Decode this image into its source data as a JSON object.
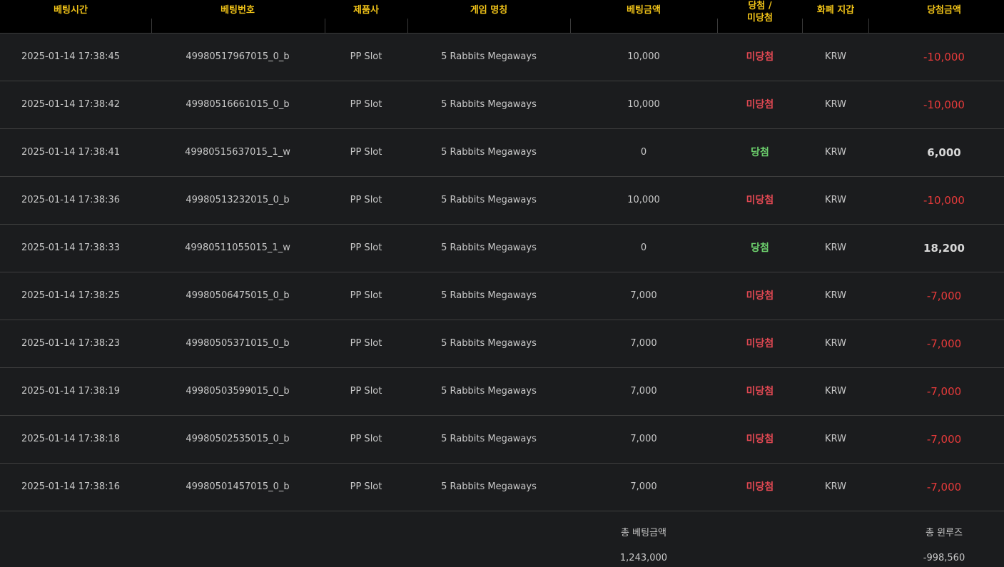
{
  "header": {
    "columns": [
      "베팅시간",
      "베팅번호",
      "제품사",
      "게임 명칭",
      "베팅금액",
      "당첨 /",
      "미당첨",
      "화폐 지갑",
      "당첨금액"
    ]
  },
  "rows": [
    {
      "time": "2025-01-14 17:38:45",
      "bet_id": "49980517967015_0_b",
      "provider": "PP Slot",
      "game": "5 Rabbits Megaways",
      "bet_amount": "10,000",
      "result": "미당첨",
      "result_type": "lose",
      "currency": "KRW",
      "win_amount": "-10,000"
    },
    {
      "time": "2025-01-14 17:38:42",
      "bet_id": "49980516661015_0_b",
      "provider": "PP Slot",
      "game": "5 Rabbits Megaways",
      "bet_amount": "10,000",
      "result": "미당첨",
      "result_type": "lose",
      "currency": "KRW",
      "win_amount": "-10,000"
    },
    {
      "time": "2025-01-14 17:38:41",
      "bet_id": "49980515637015_1_w",
      "provider": "PP Slot",
      "game": "5 Rabbits Megaways",
      "bet_amount": "0",
      "result": "당첨",
      "result_type": "win",
      "currency": "KRW",
      "win_amount": "6,000"
    },
    {
      "time": "2025-01-14 17:38:36",
      "bet_id": "49980513232015_0_b",
      "provider": "PP Slot",
      "game": "5 Rabbits Megaways",
      "bet_amount": "10,000",
      "result": "미당첨",
      "result_type": "lose",
      "currency": "KRW",
      "win_amount": "-10,000"
    },
    {
      "time": "2025-01-14 17:38:33",
      "bet_id": "49980511055015_1_w",
      "provider": "PP Slot",
      "game": "5 Rabbits Megaways",
      "bet_amount": "0",
      "result": "당첨",
      "result_type": "win",
      "currency": "KRW",
      "win_amount": "18,200"
    },
    {
      "time": "2025-01-14 17:38:25",
      "bet_id": "49980506475015_0_b",
      "provider": "PP Slot",
      "game": "5 Rabbits Megaways",
      "bet_amount": "7,000",
      "result": "미당첨",
      "result_type": "lose",
      "currency": "KRW",
      "win_amount": "-7,000"
    },
    {
      "time": "2025-01-14 17:38:23",
      "bet_id": "49980505371015_0_b",
      "provider": "PP Slot",
      "game": "5 Rabbits Megaways",
      "bet_amount": "7,000",
      "result": "미당첨",
      "result_type": "lose",
      "currency": "KRW",
      "win_amount": "-7,000"
    },
    {
      "time": "2025-01-14 17:38:19",
      "bet_id": "49980503599015_0_b",
      "provider": "PP Slot",
      "game": "5 Rabbits Megaways",
      "bet_amount": "7,000",
      "result": "미당첨",
      "result_type": "lose",
      "currency": "KRW",
      "win_amount": "-7,000"
    },
    {
      "time": "2025-01-14 17:38:18",
      "bet_id": "49980502535015_0_b",
      "provider": "PP Slot",
      "game": "5 Rabbits Megaways",
      "bet_amount": "7,000",
      "result": "미당첨",
      "result_type": "lose",
      "currency": "KRW",
      "win_amount": "-7,000"
    },
    {
      "time": "2025-01-14 17:38:16",
      "bet_id": "49980501457015_0_b",
      "provider": "PP Slot",
      "game": "5 Rabbits Megaways",
      "bet_amount": "7,000",
      "result": "미당첨",
      "result_type": "lose",
      "currency": "KRW",
      "win_amount": "-7,000"
    }
  ],
  "footer": {
    "total_bet_label": "총 베팅금액",
    "total_bet_value": "1,243,000",
    "total_winloss_label": "총 윈루즈",
    "total_winloss_value": "-998,560"
  },
  "colors": {
    "header_text": "#f2c418",
    "lose": "#e04852",
    "win": "#6ed36e",
    "negative_amount": "#e63a3a",
    "background": "#1b1c1e",
    "header_background": "#000000"
  }
}
